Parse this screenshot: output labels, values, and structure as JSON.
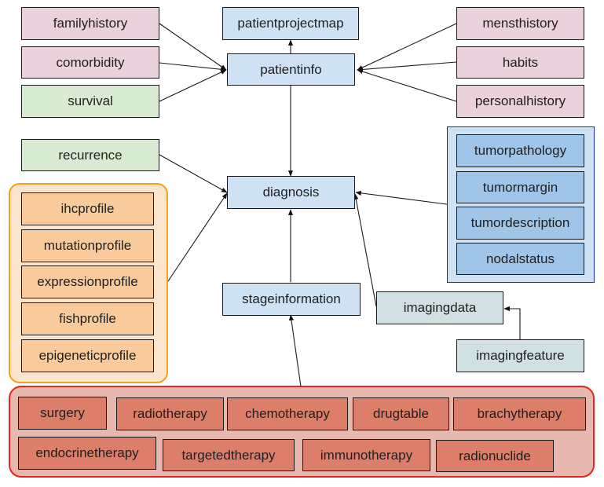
{
  "diagram": {
    "nodes": {
      "familyhistory": "familyhistory",
      "comorbidity": "comorbidity",
      "survival": "survival",
      "recurrence": "recurrence",
      "patientprojectmap": "patientprojectmap",
      "patientinfo": "patientinfo",
      "diagnosis": "diagnosis",
      "stageinformation": "stageinformation",
      "mensthistory": "mensthistory",
      "habits": "habits",
      "personalhistory": "personalhistory",
      "imagingdata": "imagingdata",
      "imagingfeature": "imagingfeature"
    },
    "groups": {
      "omics": [
        "ihcprofile",
        "mutationprofile",
        "expressionprofile",
        "fishprofile",
        "epigeneticprofile"
      ],
      "tumor": [
        "tumorpathology",
        "tumormargin",
        "tumordescription",
        "nodalstatus"
      ],
      "treatment_row1": [
        "surgery",
        "radiotherapy",
        "chemotherapy",
        "drugtable",
        "brachytherapy"
      ],
      "treatment_row2": [
        "endocrinetherapy",
        "targetedtherapy",
        "immunotherapy",
        "radionuclide"
      ]
    },
    "edges": [
      {
        "from": "familyhistory",
        "to": "patientinfo"
      },
      {
        "from": "comorbidity",
        "to": "patientinfo"
      },
      {
        "from": "survival",
        "to": "patientinfo"
      },
      {
        "from": "mensthistory",
        "to": "patientinfo"
      },
      {
        "from": "habits",
        "to": "patientinfo"
      },
      {
        "from": "personalhistory",
        "to": "patientinfo"
      },
      {
        "from": "patientinfo",
        "to": "patientprojectmap"
      },
      {
        "from": "patientinfo",
        "to": "diagnosis"
      },
      {
        "from": "recurrence",
        "to": "diagnosis"
      },
      {
        "from": "omics-group",
        "to": "diagnosis"
      },
      {
        "from": "tumor-group",
        "to": "diagnosis"
      },
      {
        "from": "imagingdata",
        "to": "diagnosis"
      },
      {
        "from": "stageinformation",
        "to": "diagnosis"
      },
      {
        "from": "treatment-group",
        "to": "stageinformation"
      },
      {
        "from": "imagingfeature",
        "to": "imagingdata"
      }
    ],
    "colors": {
      "history": "#ead1dc",
      "core": "#cfe2f3",
      "outcome": "#d9ead3",
      "omics": "#f9cb9c",
      "omics_group_border": "#f1a01f",
      "tumor": "#9fc5e8",
      "tumor_group_border": "#1c2bd1",
      "imaging": "#d0e0e3",
      "treatment": "#dd7e6b",
      "treatment_group_border": "#e8261f"
    }
  }
}
